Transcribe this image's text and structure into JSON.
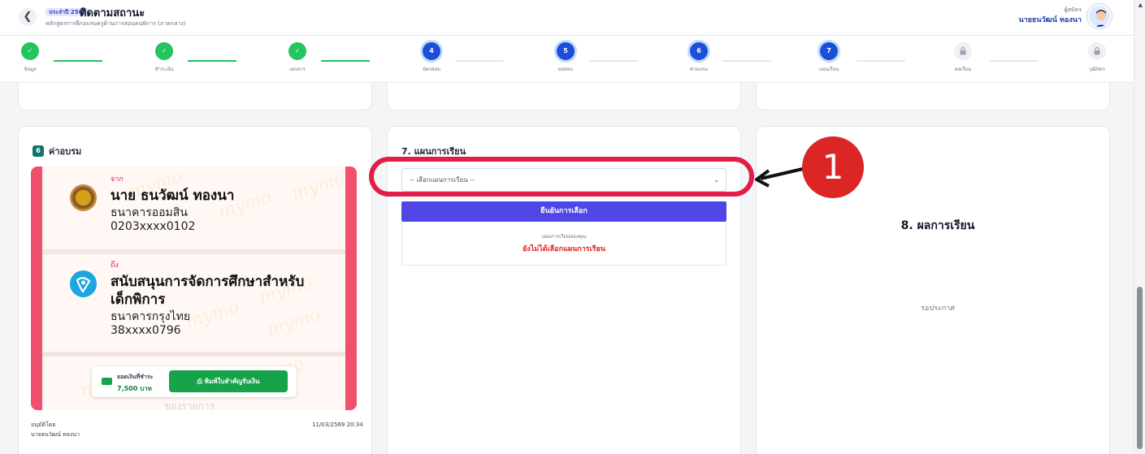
{
  "header": {
    "back_icon": "chevron-left-icon",
    "year_badge": "ประจำปี 2569",
    "title": "ติดตามสถานะ",
    "subtitle": "หลักสูตรการฝึกอบรมครูด้านการสอนคนพิการ (ภาคกลาง)",
    "user_role": "ผู้สมัคร",
    "user_name": "นายธนวัฒน์ ทองนา"
  },
  "steps": [
    {
      "label": "ข้อมูล",
      "status": "done",
      "number": ""
    },
    {
      "label": "ชำระเงิน",
      "status": "done",
      "number": ""
    },
    {
      "label": "เอกสาร",
      "status": "done",
      "number": ""
    },
    {
      "label": "บัตรสอบ",
      "status": "active",
      "number": "4"
    },
    {
      "label": "ผลสอบ",
      "status": "active",
      "number": "5"
    },
    {
      "label": "ค่าอบรม",
      "status": "active",
      "number": "6"
    },
    {
      "label": "แผนเรียน",
      "status": "active",
      "number": "7"
    },
    {
      "label": "ผลเรียน",
      "status": "locked",
      "number": ""
    },
    {
      "label": "วุฒิบัตร",
      "status": "locked",
      "number": ""
    }
  ],
  "card6": {
    "badge": "6",
    "title": "ค่าอบรม",
    "slip": {
      "from_label": "จาก",
      "from_name": "นาย ธนวัฒน์ ทองนา",
      "from_bank": "ธนาคารออมสิน",
      "from_account": "0203xxxx0102",
      "to_label": "ถึง",
      "to_name_line1": "สนับสนุนการจัดการศึกษาสำหรับ",
      "to_name_line2": "เด็กพิการ",
      "to_bank": "ธนาคารกรุงไทย",
      "to_account": "38xxxx0796",
      "watermark": "mymo",
      "faded_text": "ของรายการ"
    },
    "amount_label": "ยอดเงินที่ชำระ",
    "amount_value": "7,500 บาท",
    "print_button": "พิมพ์ใบสำคัญรับเงิน",
    "approved_label": "อนุมัติโดย",
    "approved_by": "นายธนวัฒน์ ทองนา",
    "approved_time": "11/03/2569 20:34"
  },
  "card7": {
    "title": "7. แผนการเรียน",
    "select_placeholder": "-- เลือกแผนการเรียน --",
    "confirm_button": "ยืนยันการเลือก",
    "your_plan_label": "แผนการเรียนของคุณ",
    "your_plan_value": "ยังไม่ได้เลือกแผนการเรียน"
  },
  "card8": {
    "title": "8. ผลการเรียน",
    "status": "รอประกาศ"
  },
  "annotation": {
    "number": "1"
  },
  "colors": {
    "done": "#22c55e",
    "active": "#1d4ed8",
    "primary_button": "#4f46e5",
    "annotation": "#dc2626"
  }
}
